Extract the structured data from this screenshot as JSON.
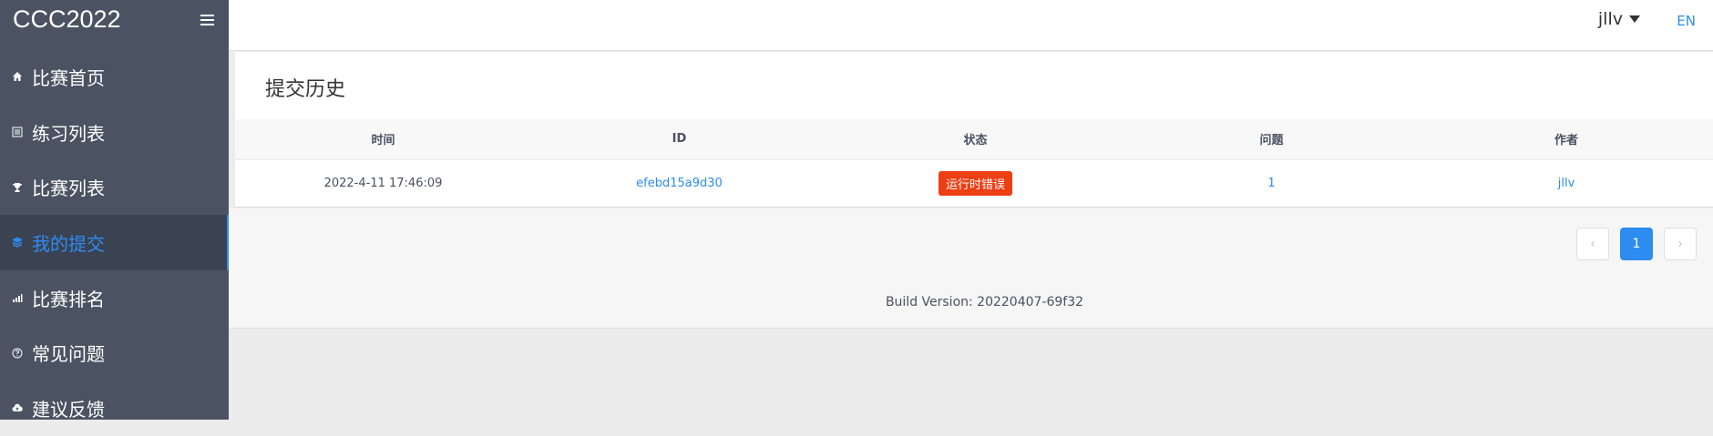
{
  "app": {
    "title": "CCC2022"
  },
  "sidebar": {
    "items": [
      {
        "label": "比赛首页",
        "icon": "home-icon"
      },
      {
        "label": "练习列表",
        "icon": "list-icon"
      },
      {
        "label": "比赛列表",
        "icon": "trophy-icon"
      },
      {
        "label": "我的提交",
        "icon": "layers-icon",
        "active": true
      },
      {
        "label": "比赛排名",
        "icon": "bar-chart-icon"
      },
      {
        "label": "常见问题",
        "icon": "help-icon"
      },
      {
        "label": "建议反馈",
        "icon": "cloud-upload-icon"
      }
    ],
    "background": "#4b5363",
    "active_color": "#2d8cf0"
  },
  "header": {
    "username": "jllv",
    "language": "EN"
  },
  "submissions": {
    "title": "提交历史",
    "columns": [
      "时间",
      "ID",
      "状态",
      "问题",
      "作者"
    ],
    "rows": [
      {
        "time": "2022-4-11 17:46:09",
        "id": "efebd15a9d30",
        "status": "运行时错误",
        "problem": "1",
        "author": "jllv"
      }
    ],
    "status_color": "#ed3f14"
  },
  "pagination": {
    "prev": "‹",
    "current": "1",
    "next": "›"
  },
  "footer": {
    "build": "Build Version: 20220407-69f32"
  }
}
